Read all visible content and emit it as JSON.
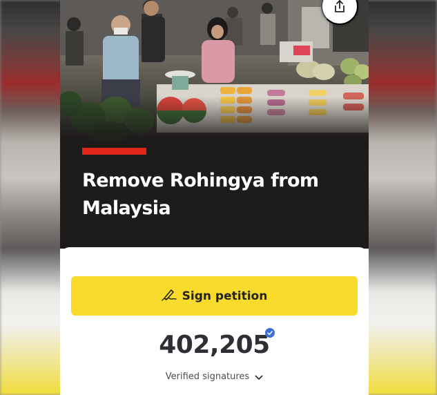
{
  "petition": {
    "title": "Remove Rohingya from Malaysia",
    "sign_label": "Sign petition",
    "signature_count": "402,205",
    "signature_label": "Verified signatures"
  },
  "icons": {
    "share": "share-icon",
    "sign": "signature-pen-icon",
    "verified": "verified-check-icon",
    "expand": "chevron-down-icon"
  },
  "colors": {
    "accent_red": "#e1251b",
    "sign_button": "#f9dc2b",
    "verified_blue": "#3b6fd8",
    "hero_background": "#1e1b1b"
  }
}
